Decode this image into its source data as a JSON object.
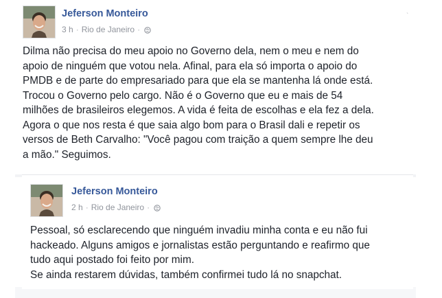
{
  "post": {
    "author": "Jeferson Monteiro",
    "time": "3 h",
    "separator": "·",
    "location": "Rio de Janeiro",
    "separator2": "·",
    "privacy_icon": "globe-icon",
    "body_lines": [
      "Dilma não precisa do meu apoio no Governo dela, nem o meu e nem do",
      "apoio de ninguém que votou nela. Afinal, para ela só importa o apoio do",
      "PMDB e de parte do empresariado para que ela se mantenha lá onde está.",
      "Trocou o Governo pelo cargo. Não é o Governo que eu e mais de 54",
      "milhões de brasileiros elegemos. A vida é feita de escolhas e ela fez a dela.",
      "Agora o que nos resta é que saia algo bom para o Brasil dali e repetir os",
      "versos de Beth Carvalho: \"Você pagou com traição a quem sempre lhe deu",
      "a mão.\" Seguimos."
    ]
  },
  "followup_post": {
    "author": "Jeferson Monteiro",
    "time": "2 h",
    "separator": "·",
    "location": "Rio de Janeiro",
    "separator2": "·",
    "privacy_icon": "globe-icon",
    "body_lines": [
      "Pessoal, só esclarecendo que ninguém invadiu minha conta e eu não fui",
      "hackeado. Alguns amigos e jornalistas estão perguntando e reafirmo que",
      "tudo aqui postado foi feito por mim.",
      "Se ainda restarem dúvidas, também confirmei tudo lá no snapchat."
    ]
  },
  "colors": {
    "author_link": "#365899",
    "meta_text": "#90949c",
    "body_text": "#1d2129"
  }
}
